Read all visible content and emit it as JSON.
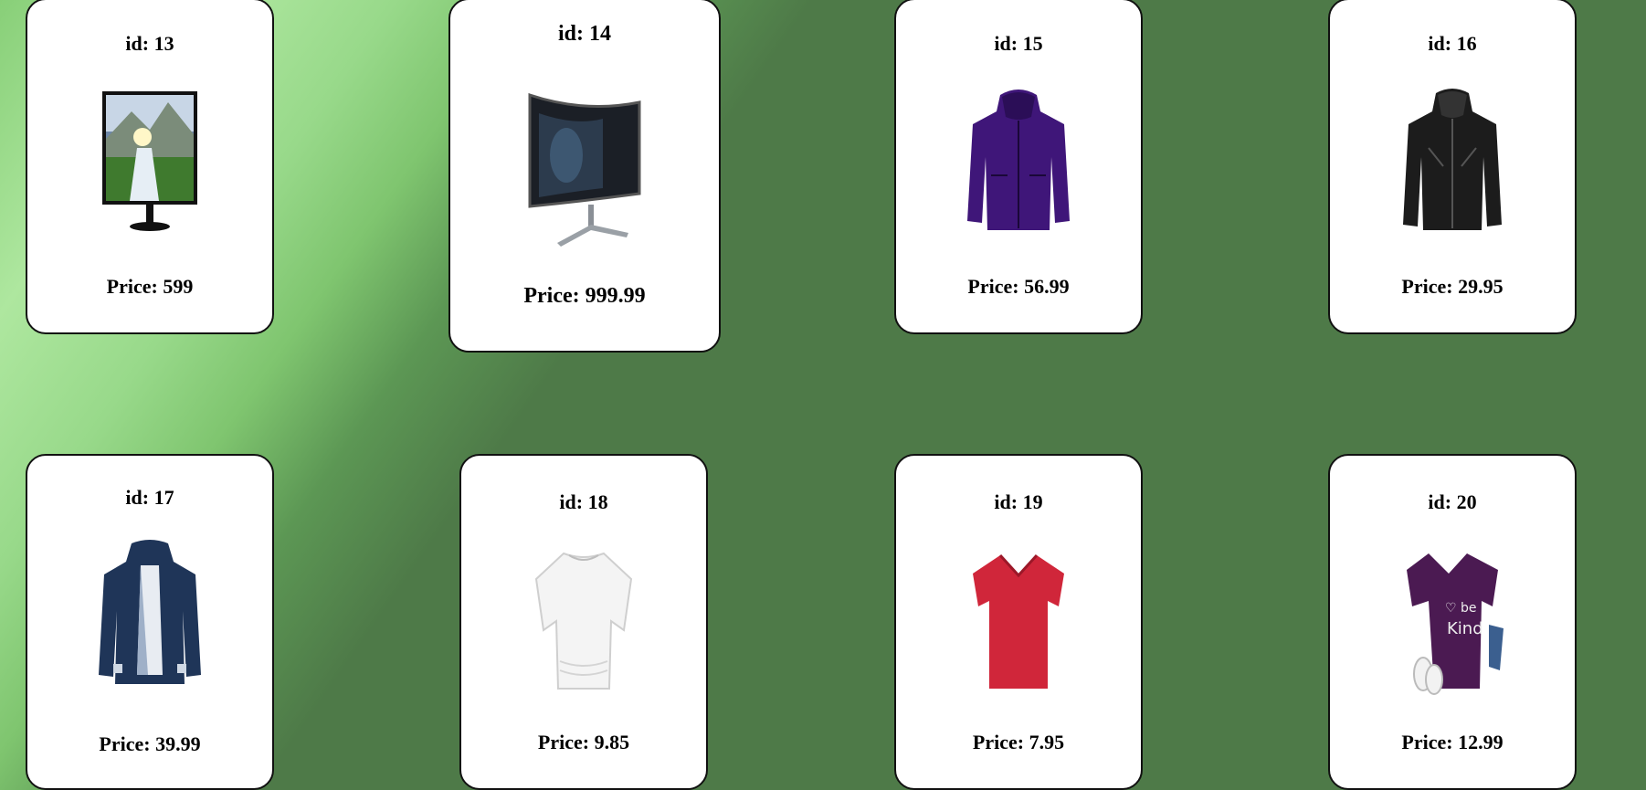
{
  "colors": {
    "background": "#4e7a48",
    "gradient_highlight": "#aee79f",
    "card": "#ffffff",
    "card_border": "#111111"
  },
  "products": [
    {
      "id_label": "id: 13",
      "price_label": "Price: 599",
      "image": "monitor-waterfall-icon"
    },
    {
      "id_label": "id: 14",
      "price_label": "Price: 999.99",
      "image": "curved-gaming-monitor-icon"
    },
    {
      "id_label": "id: 15",
      "price_label": "Price: 56.99",
      "image": "purple-jacket-icon"
    },
    {
      "id_label": "id: 16",
      "price_label": "Price: 29.95",
      "image": "black-leather-jacket-icon"
    },
    {
      "id_label": "id: 17",
      "price_label": "Price: 39.99",
      "image": "navy-raincoat-icon"
    },
    {
      "id_label": "id: 18",
      "price_label": "Price: 9.85",
      "image": "white-tshirt-icon"
    },
    {
      "id_label": "id: 19",
      "price_label": "Price: 7.95",
      "image": "red-vneck-tshirt-icon"
    },
    {
      "id_label": "id: 20",
      "price_label": "Price: 12.99",
      "image": "purple-be-kind-tshirt-icon"
    }
  ]
}
